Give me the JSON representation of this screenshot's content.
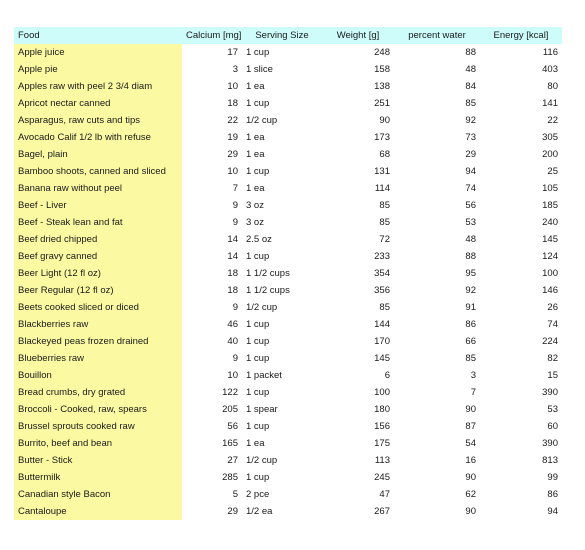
{
  "table": {
    "columns": [
      {
        "key": "food",
        "label": "Food"
      },
      {
        "key": "calcium",
        "label": "Calcium [mg]"
      },
      {
        "key": "serving",
        "label": "Serving Size"
      },
      {
        "key": "weight",
        "label": "Weight [g]"
      },
      {
        "key": "water",
        "label": "percent water"
      },
      {
        "key": "energy",
        "label": "Energy [kcal]"
      }
    ],
    "colors": {
      "header_background": "#cdfcfb",
      "food_column_background": "#fbfaa2",
      "page_background": "#ffffff",
      "text": "#1a1a1a"
    },
    "rows": [
      {
        "food": "Apple juice",
        "calcium": "17",
        "serving": "1 cup",
        "weight": "248",
        "water": "88",
        "energy": "116"
      },
      {
        "food": "Apple pie",
        "calcium": "3",
        "serving": "1 slice",
        "weight": "158",
        "water": "48",
        "energy": "403"
      },
      {
        "food": "Apples raw with peel 2 3/4 diam",
        "calcium": "10",
        "serving": "1 ea",
        "weight": "138",
        "water": "84",
        "energy": "80"
      },
      {
        "food": "Apricot nectar canned",
        "calcium": "18",
        "serving": "1 cup",
        "weight": "251",
        "water": "85",
        "energy": "141"
      },
      {
        "food": "Asparagus, raw cuts and tips",
        "calcium": "22",
        "serving": "1/2 cup",
        "weight": "90",
        "water": "92",
        "energy": "22"
      },
      {
        "food": "Avocado Calif 1/2 lb with refuse",
        "calcium": "19",
        "serving": "1 ea",
        "weight": "173",
        "water": "73",
        "energy": "305"
      },
      {
        "food": "Bagel, plain",
        "calcium": "29",
        "serving": "1 ea",
        "weight": "68",
        "water": "29",
        "energy": "200"
      },
      {
        "food": "Bamboo shoots, canned and sliced",
        "calcium": "10",
        "serving": "1 cup",
        "weight": "131",
        "water": "94",
        "energy": "25"
      },
      {
        "food": "Banana raw without peel",
        "calcium": "7",
        "serving": "1 ea",
        "weight": "114",
        "water": "74",
        "energy": "105"
      },
      {
        "food": "Beef - Liver",
        "calcium": "9",
        "serving": "3 oz",
        "weight": "85",
        "water": "56",
        "energy": "185"
      },
      {
        "food": "Beef - Steak lean and fat",
        "calcium": "9",
        "serving": "3 oz",
        "weight": "85",
        "water": "53",
        "energy": "240"
      },
      {
        "food": "Beef dried chipped",
        "calcium": "14",
        "serving": "2.5 oz",
        "weight": "72",
        "water": "48",
        "energy": "145"
      },
      {
        "food": "Beef gravy canned",
        "calcium": "14",
        "serving": "1 cup",
        "weight": "233",
        "water": "88",
        "energy": "124"
      },
      {
        "food": "Beer Light (12 fl oz)",
        "calcium": "18",
        "serving": "1 1/2 cups",
        "weight": "354",
        "water": "95",
        "energy": "100"
      },
      {
        "food": "Beer Regular (12 fl oz)",
        "calcium": "18",
        "serving": "1 1/2 cups",
        "weight": "356",
        "water": "92",
        "energy": "146"
      },
      {
        "food": "Beets cooked sliced or diced",
        "calcium": "9",
        "serving": "1/2 cup",
        "weight": "85",
        "water": "91",
        "energy": "26"
      },
      {
        "food": "Blackberries raw",
        "calcium": "46",
        "serving": "1 cup",
        "weight": "144",
        "water": "86",
        "energy": "74"
      },
      {
        "food": "Blackeyed peas frozen drained",
        "calcium": "40",
        "serving": "1 cup",
        "weight": "170",
        "water": "66",
        "energy": "224"
      },
      {
        "food": "Blueberries raw",
        "calcium": "9",
        "serving": "1 cup",
        "weight": "145",
        "water": "85",
        "energy": "82"
      },
      {
        "food": "Bouillon",
        "calcium": "10",
        "serving": "1 packet",
        "weight": "6",
        "water": "3",
        "energy": "15"
      },
      {
        "food": "Bread crumbs, dry grated",
        "calcium": "122",
        "serving": "1 cup",
        "weight": "100",
        "water": "7",
        "energy": "390"
      },
      {
        "food": "Broccoli - Cooked, raw, spears",
        "calcium": "205",
        "serving": "1 spear",
        "weight": "180",
        "water": "90",
        "energy": "53"
      },
      {
        "food": "Brussel sprouts cooked raw",
        "calcium": "56",
        "serving": "1 cup",
        "weight": "156",
        "water": "87",
        "energy": "60"
      },
      {
        "food": "Burrito, beef and bean",
        "calcium": "165",
        "serving": "1 ea",
        "weight": "175",
        "water": "54",
        "energy": "390"
      },
      {
        "food": "Butter - Stick",
        "calcium": "27",
        "serving": "1/2 cup",
        "weight": "113",
        "water": "16",
        "energy": "813"
      },
      {
        "food": "Buttermilk",
        "calcium": "285",
        "serving": "1 cup",
        "weight": "245",
        "water": "90",
        "energy": "99"
      },
      {
        "food": "Canadian style Bacon",
        "calcium": "5",
        "serving": "2 pce",
        "weight": "47",
        "water": "62",
        "energy": "86"
      },
      {
        "food": "Cantaloupe",
        "calcium": "29",
        "serving": "1/2 ea",
        "weight": "267",
        "water": "90",
        "energy": "94"
      }
    ]
  }
}
